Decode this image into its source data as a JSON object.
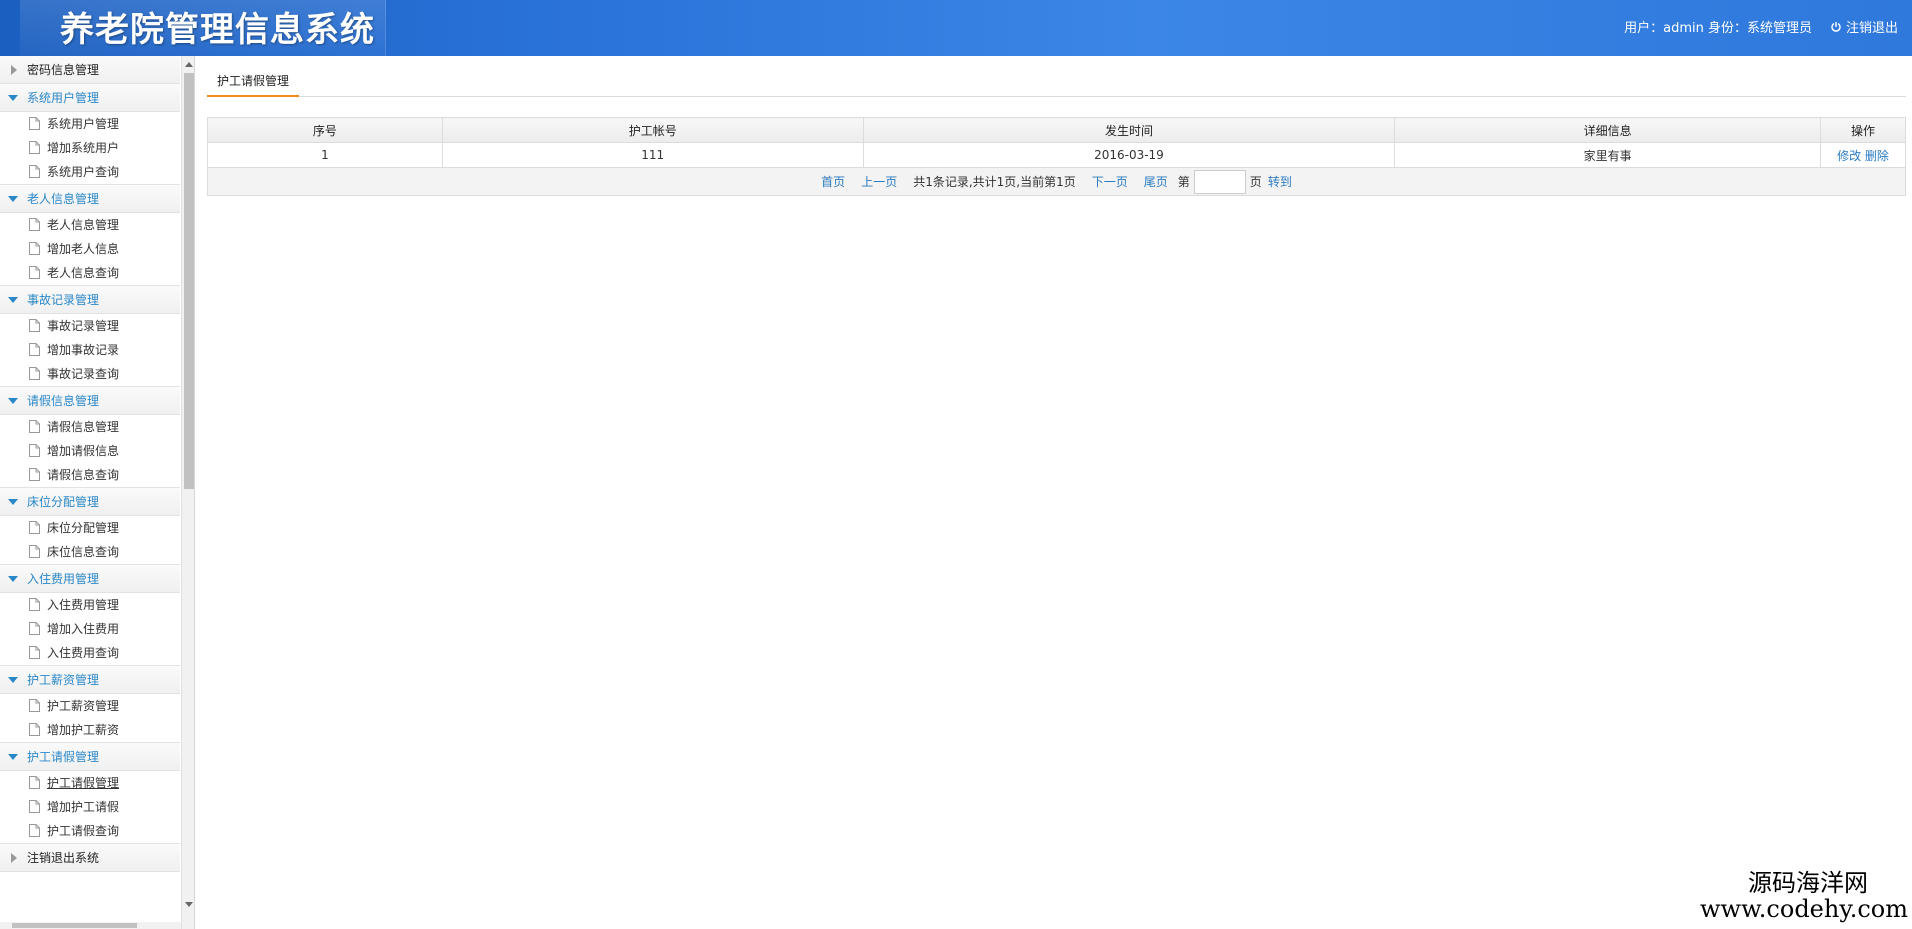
{
  "header": {
    "title": "养老院管理信息系统",
    "user_info": "用户：admin 身份：系统管理员",
    "logout_label": "注销退出"
  },
  "sidebar": {
    "groups": [
      {
        "label": "密码信息管理",
        "open": false,
        "items": []
      },
      {
        "label": "系统用户管理",
        "open": true,
        "items": [
          "系统用户管理",
          "增加系统用户",
          "系统用户查询"
        ]
      },
      {
        "label": "老人信息管理",
        "open": true,
        "items": [
          "老人信息管理",
          "增加老人信息",
          "老人信息查询"
        ]
      },
      {
        "label": "事故记录管理",
        "open": true,
        "items": [
          "事故记录管理",
          "增加事故记录",
          "事故记录查询"
        ]
      },
      {
        "label": "请假信息管理",
        "open": true,
        "items": [
          "请假信息管理",
          "增加请假信息",
          "请假信息查询"
        ]
      },
      {
        "label": "床位分配管理",
        "open": true,
        "items": [
          "床位分配管理",
          "床位信息查询"
        ]
      },
      {
        "label": "入住费用管理",
        "open": true,
        "items": [
          "入住费用管理",
          "增加入住费用",
          "入住费用查询"
        ]
      },
      {
        "label": "护工薪资管理",
        "open": true,
        "items": [
          "护工薪资管理",
          "增加护工薪资"
        ]
      },
      {
        "label": "护工请假管理",
        "open": true,
        "items": [
          "护工请假管理",
          "增加护工请假",
          "护工请假查询"
        ]
      },
      {
        "label": "注销退出系统",
        "open": false,
        "items": []
      }
    ],
    "active_item": "护工请假管理"
  },
  "main": {
    "tab_label": "护工请假管理",
    "table": {
      "columns": [
        "序号",
        "护工帐号",
        "发生时间",
        "详细信息",
        "操作"
      ],
      "rows": [
        {
          "no": "1",
          "account": "111",
          "time": "2016-03-19",
          "detail": "家里有事",
          "edit": "修改",
          "delete": "删除"
        }
      ]
    },
    "pager": {
      "first": "首页",
      "prev": "上一页",
      "info": "共1条记录,共计1页,当前第1页",
      "next": "下一页",
      "last": "尾页",
      "page_prefix": "第",
      "page_suffix": "页",
      "go": "转到",
      "page_value": ""
    }
  },
  "watermark": {
    "cn": "源码海洋网",
    "en": "www.codehy.com"
  }
}
